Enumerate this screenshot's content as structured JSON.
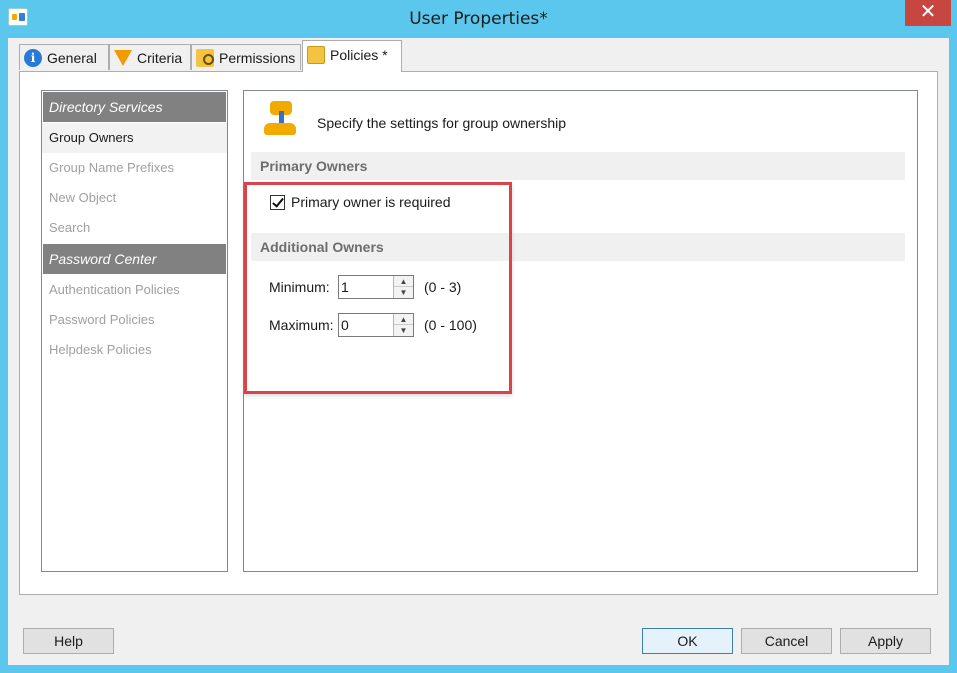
{
  "window": {
    "title": "User Properties*",
    "close_glyph": "✕"
  },
  "tabs": [
    {
      "label": "General",
      "icon": "info-icon"
    },
    {
      "label": "Criteria",
      "icon": "funnel-icon"
    },
    {
      "label": "Permissions",
      "icon": "folder-key-icon"
    },
    {
      "label": "Policies *",
      "icon": "policy-icon",
      "active": true
    }
  ],
  "sidebar": {
    "groups": [
      {
        "header": "Directory Services",
        "items": [
          "Group Owners",
          "Group Name Prefixes",
          "New Object",
          "Search"
        ]
      },
      {
        "header": "Password Center",
        "items": [
          "Authentication Policies",
          "Password Policies",
          "Helpdesk Policies"
        ]
      }
    ],
    "selected": "Group Owners"
  },
  "content": {
    "description": "Specify the settings for group ownership",
    "primary_section": "Primary Owners",
    "primary_checkbox": {
      "label": "Primary owner is required",
      "checked": true
    },
    "additional_section": "Additional Owners",
    "minimum": {
      "label": "Minimum:",
      "value": "1",
      "range": "(0 - 3)"
    },
    "maximum": {
      "label": "Maximum:",
      "value": "0",
      "range": "(0 - 100)"
    }
  },
  "buttons": {
    "help": "Help",
    "ok": "OK",
    "cancel": "Cancel",
    "apply": "Apply"
  },
  "colors": {
    "title_bar": "#5bc7ec",
    "close_button": "#c7463f",
    "highlight_box": "#d9444a",
    "nav_header": "#818181"
  }
}
